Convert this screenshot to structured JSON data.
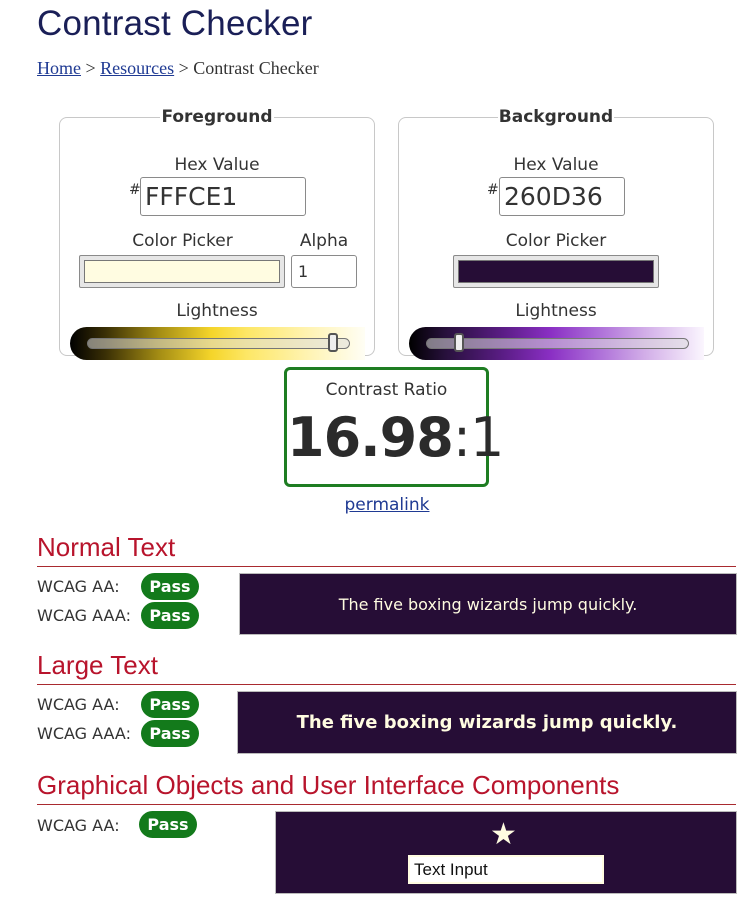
{
  "page": {
    "title": "Contrast Checker",
    "breadcrumb": [
      {
        "label": "Home",
        "link": true
      },
      {
        "label": "Resources",
        "link": true
      },
      {
        "label": "Contrast Checker",
        "link": false
      }
    ],
    "separator": ">"
  },
  "foreground": {
    "legend": "Foreground",
    "hex_label": "Hex Value",
    "hash": "#",
    "hex_value": "FFFCE1",
    "picker_label": "Color Picker",
    "color": "#fffce1",
    "alpha_label": "Alpha",
    "alpha_value": "1",
    "lightness_label": "Lightness",
    "lightness_fraction": 0.94
  },
  "background": {
    "legend": "Background",
    "hex_label": "Hex Value",
    "hash": "#",
    "hex_value": "260D36",
    "picker_label": "Color Picker",
    "color": "#260d36",
    "lightness_label": "Lightness",
    "lightness_fraction": 0.13
  },
  "result": {
    "label": "Contrast Ratio",
    "ratio": "16.98",
    "suffix": ":1",
    "permalink": "permalink",
    "pass_color": "#137a1b"
  },
  "sections": {
    "normal": {
      "title": "Normal Text",
      "aa_label": "WCAG AA:",
      "aa_result": "Pass",
      "aaa_label": "WCAG AAA:",
      "aaa_result": "Pass",
      "sample": "The five boxing wizards jump quickly."
    },
    "large": {
      "title": "Large Text",
      "aa_label": "WCAG AA:",
      "aa_result": "Pass",
      "aaa_label": "WCAG AAA:",
      "aaa_result": "Pass",
      "sample": "The five boxing wizards jump quickly."
    },
    "graphical": {
      "title": "Graphical Objects and User Interface Components",
      "aa_label": "WCAG AA:",
      "aa_result": "Pass",
      "star": "★",
      "input_value": "Text Input"
    }
  }
}
